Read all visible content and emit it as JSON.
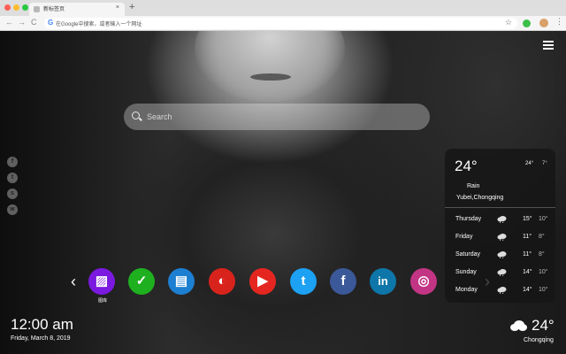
{
  "browser": {
    "tab_title": "新标签页",
    "tab_close": "×",
    "new_tab": "+",
    "nav": {
      "back": "←",
      "forward": "→",
      "reload": "C"
    },
    "omnibox_logo": "G",
    "omnibox_text": "在Google中搜索，或者输入一个网址",
    "bookmark_star": "☆",
    "menu": "⋮",
    "traffic_lights": [
      "#ff5f57",
      "#febc2e",
      "#28c840"
    ]
  },
  "search": {
    "placeholder": "Search"
  },
  "social_icons": [
    {
      "name": "facebook-icon",
      "glyph": "f"
    },
    {
      "name": "twitter-icon",
      "glyph": "t"
    },
    {
      "name": "snapchat-icon",
      "glyph": "s"
    },
    {
      "name": "wechat-icon",
      "glyph": "w"
    }
  ],
  "shortcuts": {
    "prev_arrow": "‹",
    "next_arrow": "›",
    "first_label": "图库",
    "apps": [
      {
        "name": "gallery-app-icon",
        "glyph": "▨",
        "color": "#7b19e0"
      },
      {
        "name": "check-app-icon",
        "glyph": "✓",
        "color": "#1fb01f"
      },
      {
        "name": "notes-app-icon",
        "glyph": "▤",
        "color": "#1d7fd1"
      },
      {
        "name": "red-app-icon",
        "glyph": "◐",
        "color": "#d8231c"
      },
      {
        "name": "youtube-icon",
        "glyph": "▶",
        "color": "#e52620"
      },
      {
        "name": "twitter-icon",
        "glyph": "t",
        "color": "#1da1f2"
      },
      {
        "name": "facebook-icon",
        "glyph": "f",
        "color": "#3b5998"
      },
      {
        "name": "linkedin-icon",
        "glyph": "in",
        "color": "#0e76a8"
      },
      {
        "name": "instagram-icon",
        "glyph": "◎",
        "color": "#c13584"
      }
    ]
  },
  "clock": {
    "time": "12:00 am",
    "date": "Friday, March 8, 2019"
  },
  "weather": {
    "temp": "24°",
    "unit_c": "24°",
    "unit_f": "7°",
    "condition": "Rain",
    "location": "Yubei,Chongqing",
    "forecast": [
      {
        "day": "Thursday",
        "high": "15°",
        "low": "10°"
      },
      {
        "day": "Friday",
        "high": "11°",
        "low": "8°"
      },
      {
        "day": "Saturday",
        "high": "11°",
        "low": "8°"
      },
      {
        "day": "Sunday",
        "high": "14°",
        "low": "10°"
      },
      {
        "day": "Monday",
        "high": "14°",
        "low": "10°"
      }
    ]
  },
  "corner_weather": {
    "temp": "24°",
    "city": "Chongqing"
  }
}
